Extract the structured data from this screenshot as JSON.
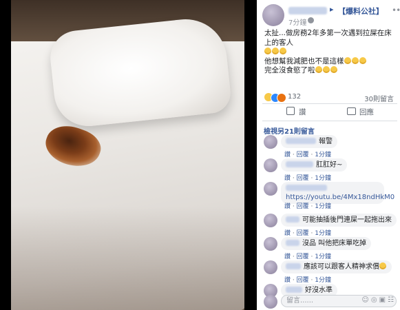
{
  "post": {
    "page_name": "【爆料公社】",
    "time": "7分鐘",
    "lines": [
      "太扯...做房務2年多第一次遇到拉屎在床上的客人",
      "他想幫我減肥也不是這樣",
      "完全沒食慾了啦"
    ],
    "reaction_count": "132",
    "comment_count": "30則留言",
    "like_label": "讚",
    "comment_label": "回應"
  },
  "view_more": "檢視另21則留言",
  "comment_meta": {
    "like": "讚",
    "reply": "回覆",
    "time": "1分鐘"
  },
  "comments": [
    {
      "text": "報警"
    },
    {
      "text": "肛肛好~"
    },
    {
      "text": "https://youtu.be/4Mx18ndHkM0"
    },
    {
      "text": "可能抽插後門連屎一起拖出來"
    },
    {
      "text": "沒品 叫他把床單吃掉"
    },
    {
      "text": "應該可以跟客人精神求償"
    },
    {
      "text": "好沒水準"
    }
  ],
  "composer": {
    "placeholder": "留言......"
  },
  "icons": [
    "globe-icon",
    "more-icon",
    "like-icon",
    "comment-icon"
  ]
}
